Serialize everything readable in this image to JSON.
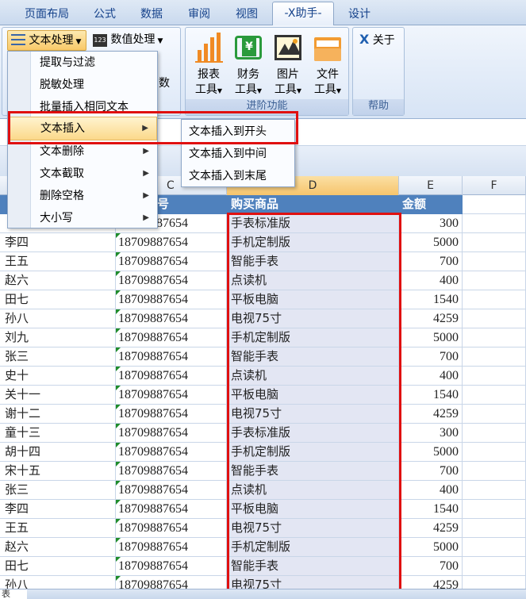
{
  "tabs": [
    "页面布局",
    "公式",
    "数据",
    "审阅",
    "视图",
    "-X助手-",
    "设计"
  ],
  "ribbon": {
    "text_btn": "文本处理",
    "num_btn": "数值处理",
    "num_badge": "123",
    "partial_label": "数",
    "big_buttons": [
      {
        "line1": "报表",
        "line2": "工具"
      },
      {
        "line1": "财务",
        "line2": "工具"
      },
      {
        "line1": "图片",
        "line2": "工具"
      },
      {
        "line1": "文件",
        "line2": "工具"
      }
    ],
    "about": "关于",
    "group_advanced": "进阶功能",
    "group_help": "帮助"
  },
  "menu": {
    "items": [
      {
        "label": "提取与过滤",
        "sub": false
      },
      {
        "label": "脱敏处理",
        "sub": false
      },
      {
        "label": "批量插入相同文本",
        "sub": false
      },
      {
        "label": "文本插入",
        "sub": true
      },
      {
        "label": "文本删除",
        "sub": true
      },
      {
        "label": "文本截取",
        "sub": true
      },
      {
        "label": "删除空格",
        "sub": true
      },
      {
        "label": "大小写",
        "sub": true
      }
    ],
    "submenu": [
      "文本插入到开头",
      "文本插入到中间",
      "文本插入到末尾"
    ],
    "arrow": "▶"
  },
  "columns": {
    "c": "C",
    "d": "D",
    "e": "E",
    "f": "F"
  },
  "table": {
    "header_product": "购买商品",
    "header_amount": "金额",
    "header_phone_partial": "号",
    "rows": [
      {
        "name": "",
        "phone": "18709887654",
        "product": "手表标准版",
        "amount": "300"
      },
      {
        "name": "李四",
        "phone": "18709887654",
        "product": "手机定制版",
        "amount": "5000"
      },
      {
        "name": "王五",
        "phone": "18709887654",
        "product": "智能手表",
        "amount": "700"
      },
      {
        "name": "赵六",
        "phone": "18709887654",
        "product": "点读机",
        "amount": "400"
      },
      {
        "name": "田七",
        "phone": "18709887654",
        "product": "平板电脑",
        "amount": "1540"
      },
      {
        "name": "孙八",
        "phone": "18709887654",
        "product": "电视75寸",
        "amount": "4259"
      },
      {
        "name": "刘九",
        "phone": "18709887654",
        "product": "手机定制版",
        "amount": "5000"
      },
      {
        "name": "张三",
        "phone": "18709887654",
        "product": "智能手表",
        "amount": "700"
      },
      {
        "name": "史十",
        "phone": "18709887654",
        "product": "点读机",
        "amount": "400"
      },
      {
        "name": "关十一",
        "phone": "18709887654",
        "product": "平板电脑",
        "amount": "1540"
      },
      {
        "name": "谢十二",
        "phone": "18709887654",
        "product": "电视75寸",
        "amount": "4259"
      },
      {
        "name": "童十三",
        "phone": "18709887654",
        "product": "手表标准版",
        "amount": "300"
      },
      {
        "name": "胡十四",
        "phone": "18709887654",
        "product": "手机定制版",
        "amount": "5000"
      },
      {
        "name": "宋十五",
        "phone": "18709887654",
        "product": "智能手表",
        "amount": "700"
      },
      {
        "name": "张三",
        "phone": "18709887654",
        "product": "点读机",
        "amount": "400"
      },
      {
        "name": "李四",
        "phone": "18709887654",
        "product": "平板电脑",
        "amount": "1540"
      },
      {
        "name": "王五",
        "phone": "18709887654",
        "product": "电视75寸",
        "amount": "4259"
      },
      {
        "name": "赵六",
        "phone": "18709887654",
        "product": "手机定制版",
        "amount": "5000"
      },
      {
        "name": "田七",
        "phone": "18709887654",
        "product": "智能手表",
        "amount": "700"
      },
      {
        "name": "孙八",
        "phone": "18709887654",
        "product": "电视75寸",
        "amount": "4259"
      }
    ]
  },
  "sheet_tab": "表"
}
